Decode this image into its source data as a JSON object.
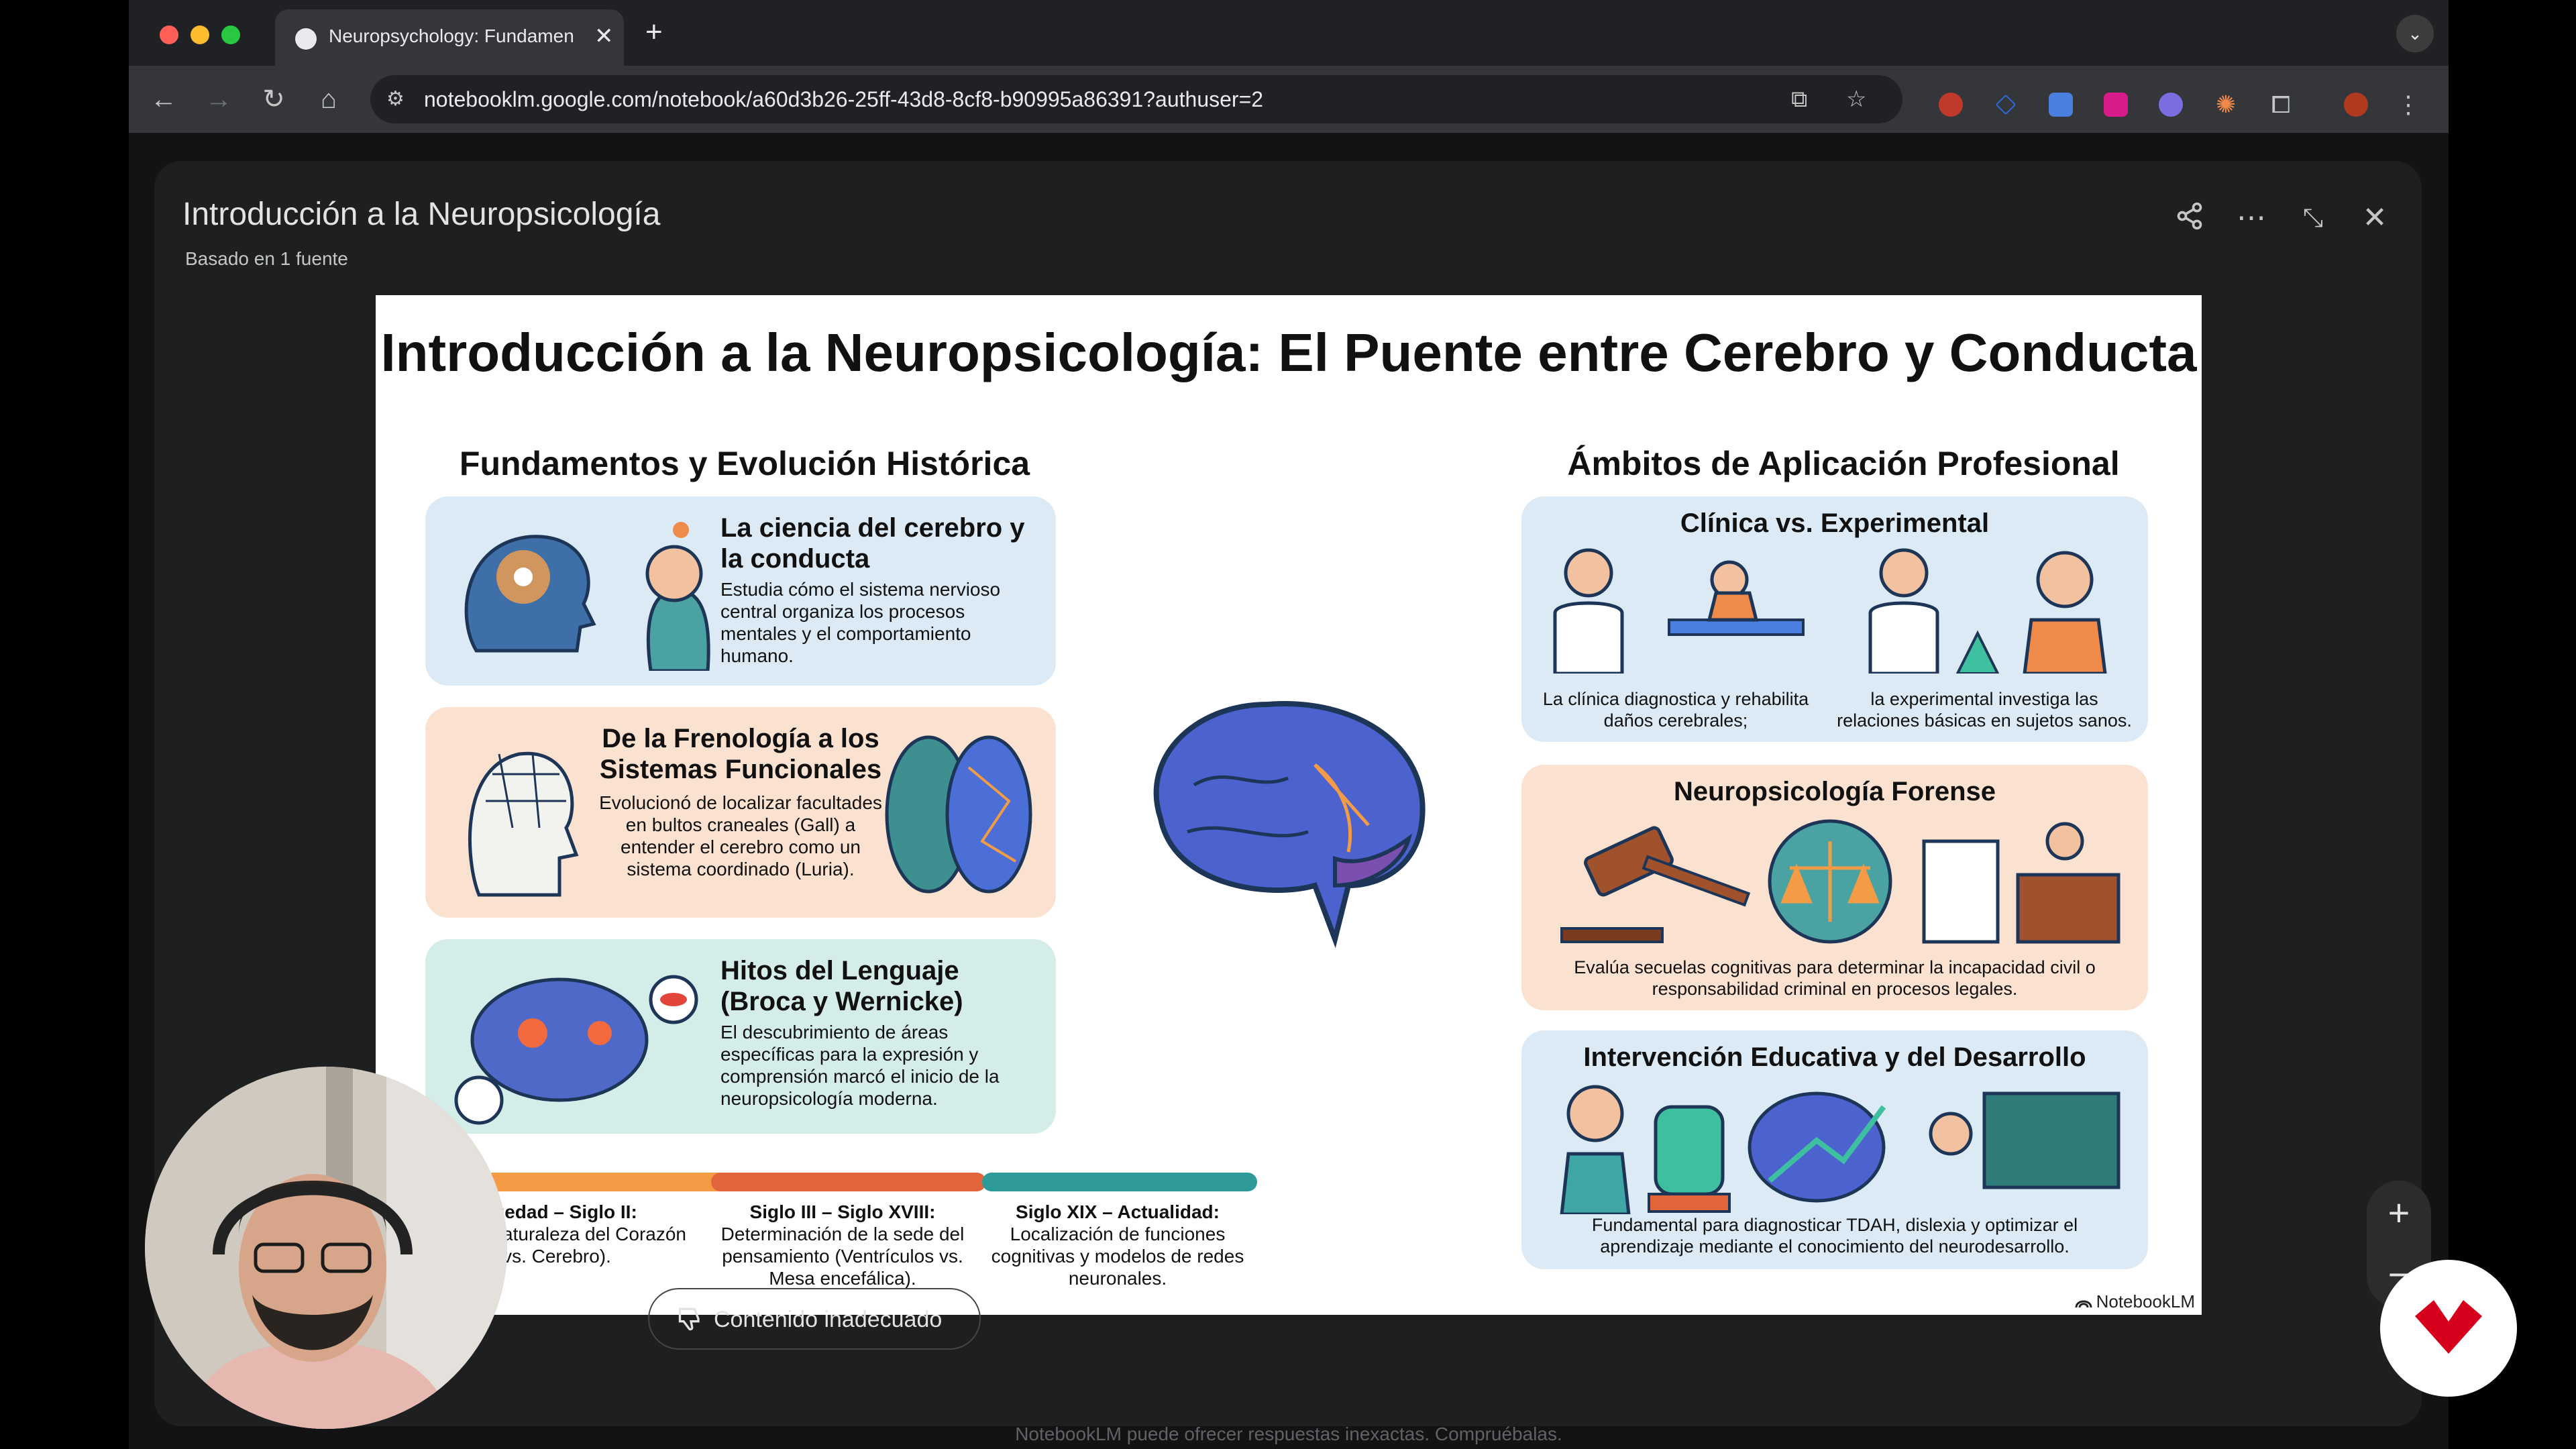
{
  "browser": {
    "tab_title": "Neuropsychology: Fundamen",
    "url": "notebooklm.google.com/notebook/a60d3b26-25ff-43d8-8cf8-b90995a86391?authuser=2"
  },
  "modal": {
    "title": "Introducción a la Neuropsicología",
    "subtitle": "Basado en 1 fuente"
  },
  "infographic": {
    "title": "Introducción a la Neuropsicología: El Puente entre Cerebro y Conducta",
    "left_column": {
      "heading": "Fundamentos y Evolución Histórica",
      "cards": [
        {
          "title": "La ciencia del cerebro y la conducta",
          "text": "Estudia cómo el sistema nervioso central organiza los procesos mentales y el comportamiento humano."
        },
        {
          "title": "De la Frenología a los Sistemas Funcionales",
          "text": "Evolucionó de localizar facultades en bultos craneales (Gall) a entender el cerebro como un sistema coordinado (Luria)."
        },
        {
          "title": "Hitos del Lenguaje (Broca y Wernicke)",
          "text": "El descubrimiento de áreas específicas para la expresión y comprensión marcó el inicio de la neuropsicología moderna."
        }
      ]
    },
    "timeline": [
      {
        "title": "igüedad – Siglo II:",
        "text": "ación y naturaleza del Corazón vs. Cerebro)."
      },
      {
        "title": "Siglo III – Siglo XVIII:",
        "text": "Determinación de la sede del pensamiento (Ventrículos vs. Mesa encefálica)."
      },
      {
        "title": "Siglo XIX – Actualidad:",
        "text": "Localización de funciones cognitivas y modelos de redes neuronales."
      }
    ],
    "right_column": {
      "heading": "Ámbitos de Aplicación Profesional",
      "cards": [
        {
          "title": "Clínica vs. Experimental",
          "caption_left": "La clínica diagnostica y rehabilita daños cerebrales;",
          "caption_right": "la experimental investiga las relaciones básicas en sujetos sanos."
        },
        {
          "title": "Neuropsicología Forense",
          "caption": "Evalúa secuelas cognitivas para determinar la incapacidad civil o responsabilidad criminal en procesos legales."
        },
        {
          "title": "Intervención Educativa y del Desarrollo",
          "caption": "Fundamental para diagnosticar TDAH, dislexia y optimizar el aprendizaje mediante el conocimiento del neurodesarrollo."
        }
      ]
    },
    "watermark": "NotebookLM"
  },
  "footer": {
    "report_label": "Contenido inadecuado",
    "disclaimer": "NotebookLM puede ofrecer respuestas inexactas. Compruébalas."
  },
  "colors": {
    "card_blue": "#dbeaf5",
    "card_peach": "#fbe1cf",
    "card_teal": "#d4ede9",
    "timeline_orange": "#f39c45",
    "timeline_red": "#e2643a",
    "timeline_teal": "#2f9a9a",
    "brand_red": "#d6001c"
  }
}
